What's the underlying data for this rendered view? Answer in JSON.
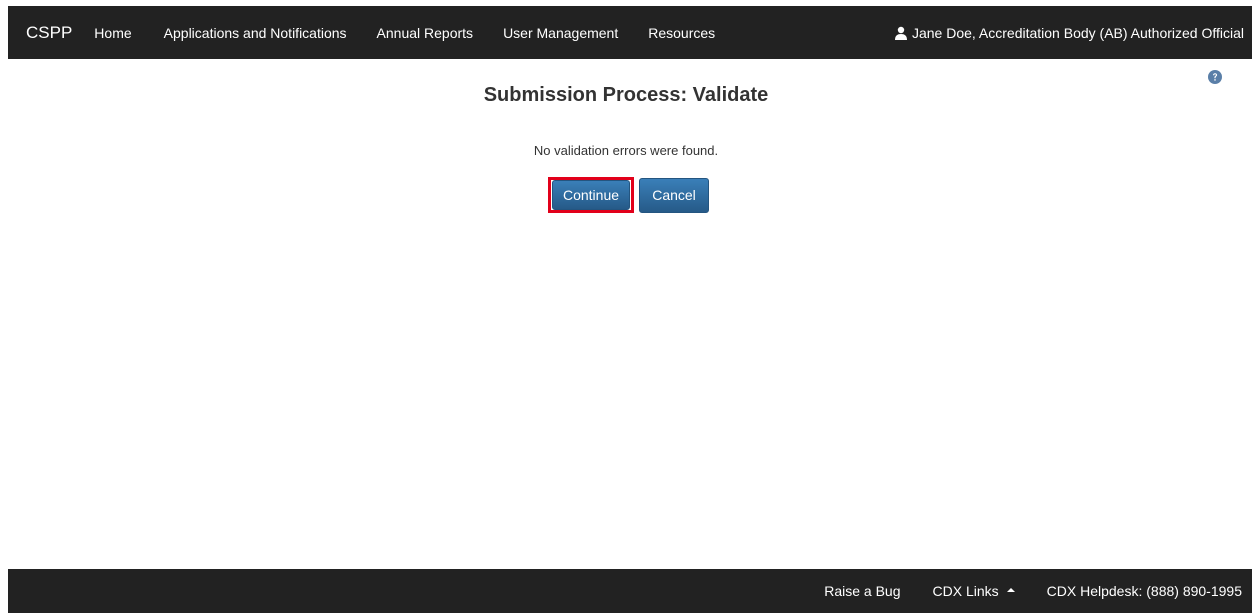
{
  "navbar": {
    "brand": "CSPP",
    "items": [
      {
        "label": "Home"
      },
      {
        "label": "Applications and Notifications"
      },
      {
        "label": "Annual Reports"
      },
      {
        "label": "User Management"
      },
      {
        "label": "Resources"
      }
    ],
    "user": {
      "icon": "user-icon",
      "label": "Jane Doe, Accreditation Body (AB) Authorized Official"
    }
  },
  "help": {
    "icon": "question-circle-icon"
  },
  "main": {
    "title": "Submission Process: Validate",
    "message": "No validation errors were found.",
    "continue_label": "Continue",
    "cancel_label": "Cancel"
  },
  "footer": {
    "raise_bug": "Raise a Bug",
    "cdx_links": "CDX Links",
    "helpdesk": "CDX Helpdesk: (888) 890-1995"
  },
  "colors": {
    "navbar_bg": "#222222",
    "button_primary": "#2e6da4",
    "highlight": "#e2001a",
    "help_icon": "#5a7fa8"
  }
}
